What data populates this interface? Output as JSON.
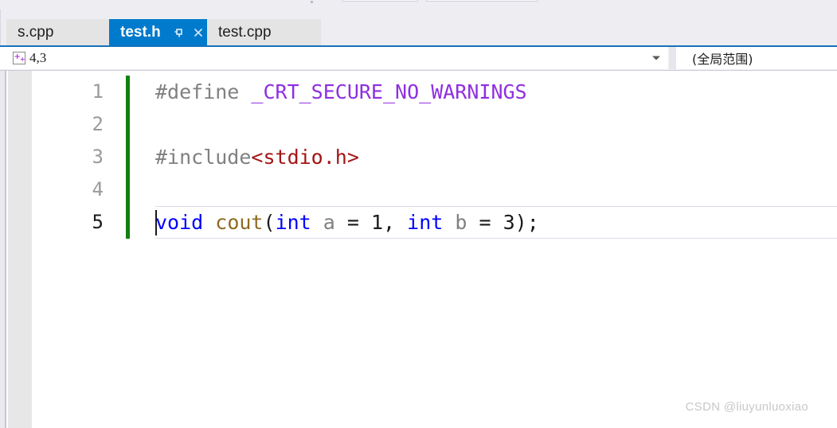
{
  "window": {
    "background_color": "#eeeef2"
  },
  "tabs": {
    "items": [
      {
        "label": "s.cpp",
        "active": false
      },
      {
        "label": "test.h",
        "active": true
      },
      {
        "label": "test.cpp",
        "active": false
      }
    ],
    "active_tab_color": "#007acc",
    "inactive_tab_color": "#e4e4e4",
    "pin_icon": "pin-icon",
    "close_icon": "close-icon"
  },
  "navbar": {
    "project_badge_icon": "cpp-file-icon",
    "project_value": "4,3",
    "dropdown_caret_icon": "chevron-down-icon",
    "scope_value": "(全局范围)",
    "accent_color": "#1672bc"
  },
  "editor": {
    "change_bar_color": "#108010",
    "current_line": 5,
    "lines": [
      {
        "number": "1",
        "changed": true,
        "tokens": [
          {
            "text": "#define ",
            "type": "pre"
          },
          {
            "text": "_CRT_SECURE_NO_WARNINGS",
            "type": "macro"
          }
        ]
      },
      {
        "number": "2",
        "changed": true,
        "tokens": []
      },
      {
        "number": "3",
        "changed": true,
        "tokens": [
          {
            "text": "#include",
            "type": "pre"
          },
          {
            "text": "<stdio.h>",
            "type": "str"
          }
        ]
      },
      {
        "number": "4",
        "changed": true,
        "tokens": []
      },
      {
        "number": "5",
        "changed": true,
        "tokens": [
          {
            "text": "void",
            "type": "kw"
          },
          {
            "text": " ",
            "type": "plain"
          },
          {
            "text": "cout",
            "type": "fn"
          },
          {
            "text": "(",
            "type": "plain"
          },
          {
            "text": "int",
            "type": "kw"
          },
          {
            "text": " ",
            "type": "plain"
          },
          {
            "text": "a",
            "type": "var"
          },
          {
            "text": " = 1, ",
            "type": "plain"
          },
          {
            "text": "int",
            "type": "kw"
          },
          {
            "text": " ",
            "type": "plain"
          },
          {
            "text": "b",
            "type": "var"
          },
          {
            "text": " = 3);",
            "type": "plain"
          }
        ]
      }
    ]
  },
  "watermark": {
    "text": "CSDN @liuyunluoxiao"
  }
}
